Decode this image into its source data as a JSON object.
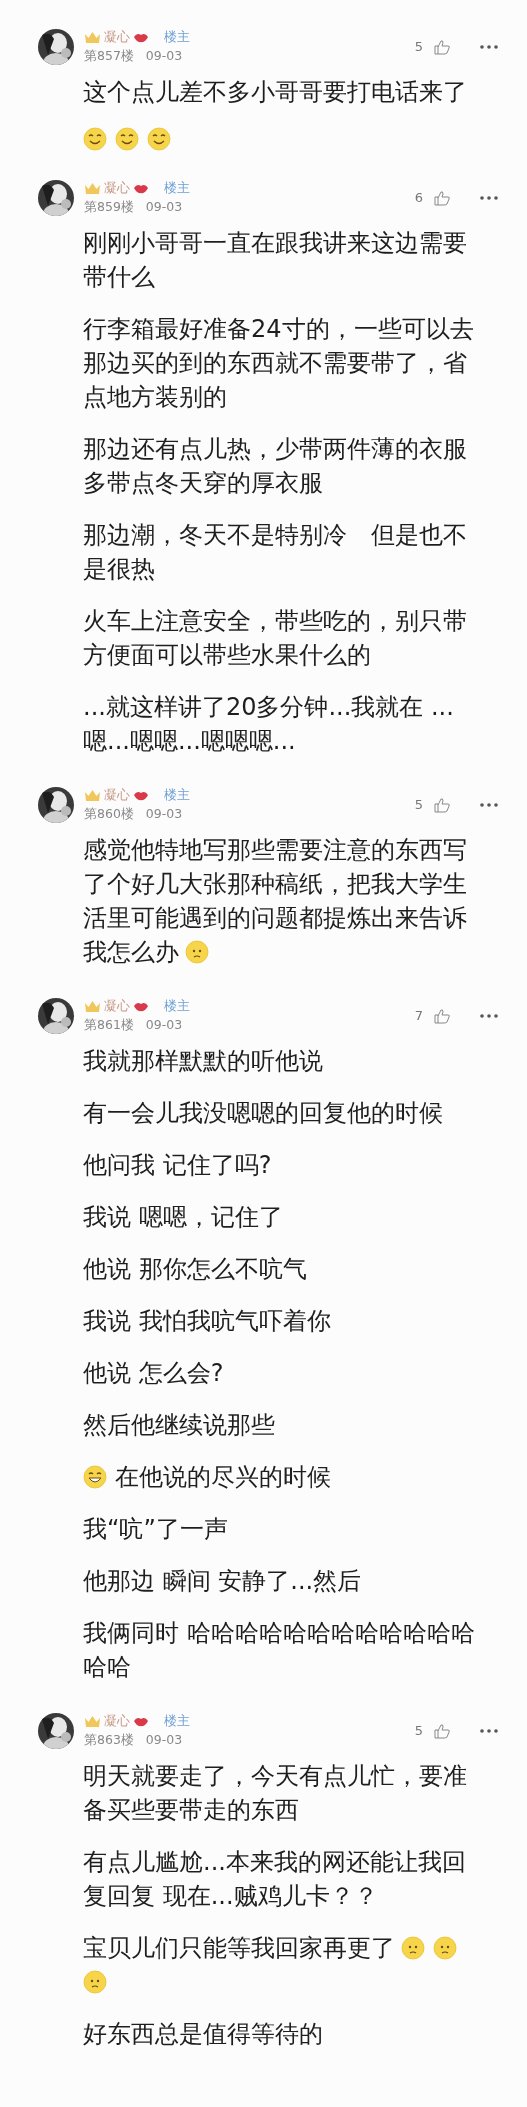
{
  "posts": [
    {
      "author": "凝心",
      "badge": "楼主",
      "floor": "第857楼",
      "date": "09-03",
      "likes": "5",
      "paragraphs": [
        {
          "text": "这个点儿差不多小哥哥要打电话来了"
        },
        {
          "emojis_after": [
            {
              "kind": "smile"
            },
            {
              "kind": "smile"
            },
            {
              "kind": "smile"
            }
          ]
        }
      ]
    },
    {
      "author": "凝心",
      "badge": "楼主",
      "floor": "第859楼",
      "date": "09-03",
      "likes": "6",
      "paragraphs": [
        {
          "text": "刚刚小哥哥一直在跟我讲来这边需要带什么"
        },
        {
          "text": "行李箱最好准备24寸的，一些可以去那边买的到的东西就不需要带了，省点地方装别的"
        },
        {
          "text": "那边还有点儿热，少带两件薄的衣服多带点冬天穿的厚衣服"
        },
        {
          "text": "那边潮，冬天不是特别冷　但是也不是很热"
        },
        {
          "text": "火车上注意安全，带些吃的，别只带方便面可以带些水果什么的"
        },
        {
          "text": "...就这样讲了20多分钟...我就在 ...嗯...嗯嗯...嗯嗯嗯..."
        }
      ]
    },
    {
      "author": "凝心",
      "badge": "楼主",
      "floor": "第860楼",
      "date": "09-03",
      "likes": "5",
      "paragraphs": [
        {
          "text": "感觉他特地写那些需要注意的东西写了个好几大张那种稿纸，把我大学生活里可能遇到的问题都提炼出来告诉我怎么办",
          "emojis_after": [
            {
              "kind": "worried"
            }
          ]
        }
      ]
    },
    {
      "author": "凝心",
      "badge": "楼主",
      "floor": "第861楼",
      "date": "09-03",
      "likes": "7",
      "paragraphs": [
        {
          "text": "我就那样默默的听他说"
        },
        {
          "text": "有一会儿我没嗯嗯的回复他的时候"
        },
        {
          "text": "他问我 记住了吗?"
        },
        {
          "text": "我说 嗯嗯，记住了"
        },
        {
          "text": "他说 那你怎么不吭气"
        },
        {
          "text": "我说 我怕我吭气吓着你"
        },
        {
          "text": "他说 怎么会?"
        },
        {
          "text": "然后他继续说那些"
        },
        {
          "text": "在他说的尽兴的时候",
          "emojis_before": [
            {
              "kind": "grin"
            }
          ]
        },
        {
          "text": "我“吭”了一声"
        },
        {
          "text": "他那边 瞬间 安静了...然后"
        },
        {
          "text": "我俩同时 哈哈哈哈哈哈哈哈哈哈哈哈哈哈"
        }
      ]
    },
    {
      "author": "凝心",
      "badge": "楼主",
      "floor": "第863楼",
      "date": "09-03",
      "likes": "5",
      "paragraphs": [
        {
          "text": "明天就要走了，今天有点儿忙，要准备买些要带走的东西"
        },
        {
          "text": "有点儿尴尬...本来我的网还能让我回复回复 现在...贼鸡儿卡？？"
        },
        {
          "text": "宝贝儿们只能等我回家再更了",
          "emojis_after": [
            {
              "kind": "worried"
            },
            {
              "kind": "worried"
            },
            {
              "kind": "worried"
            }
          ]
        },
        {
          "text": "好东西总是值得等待的"
        }
      ]
    }
  ]
}
